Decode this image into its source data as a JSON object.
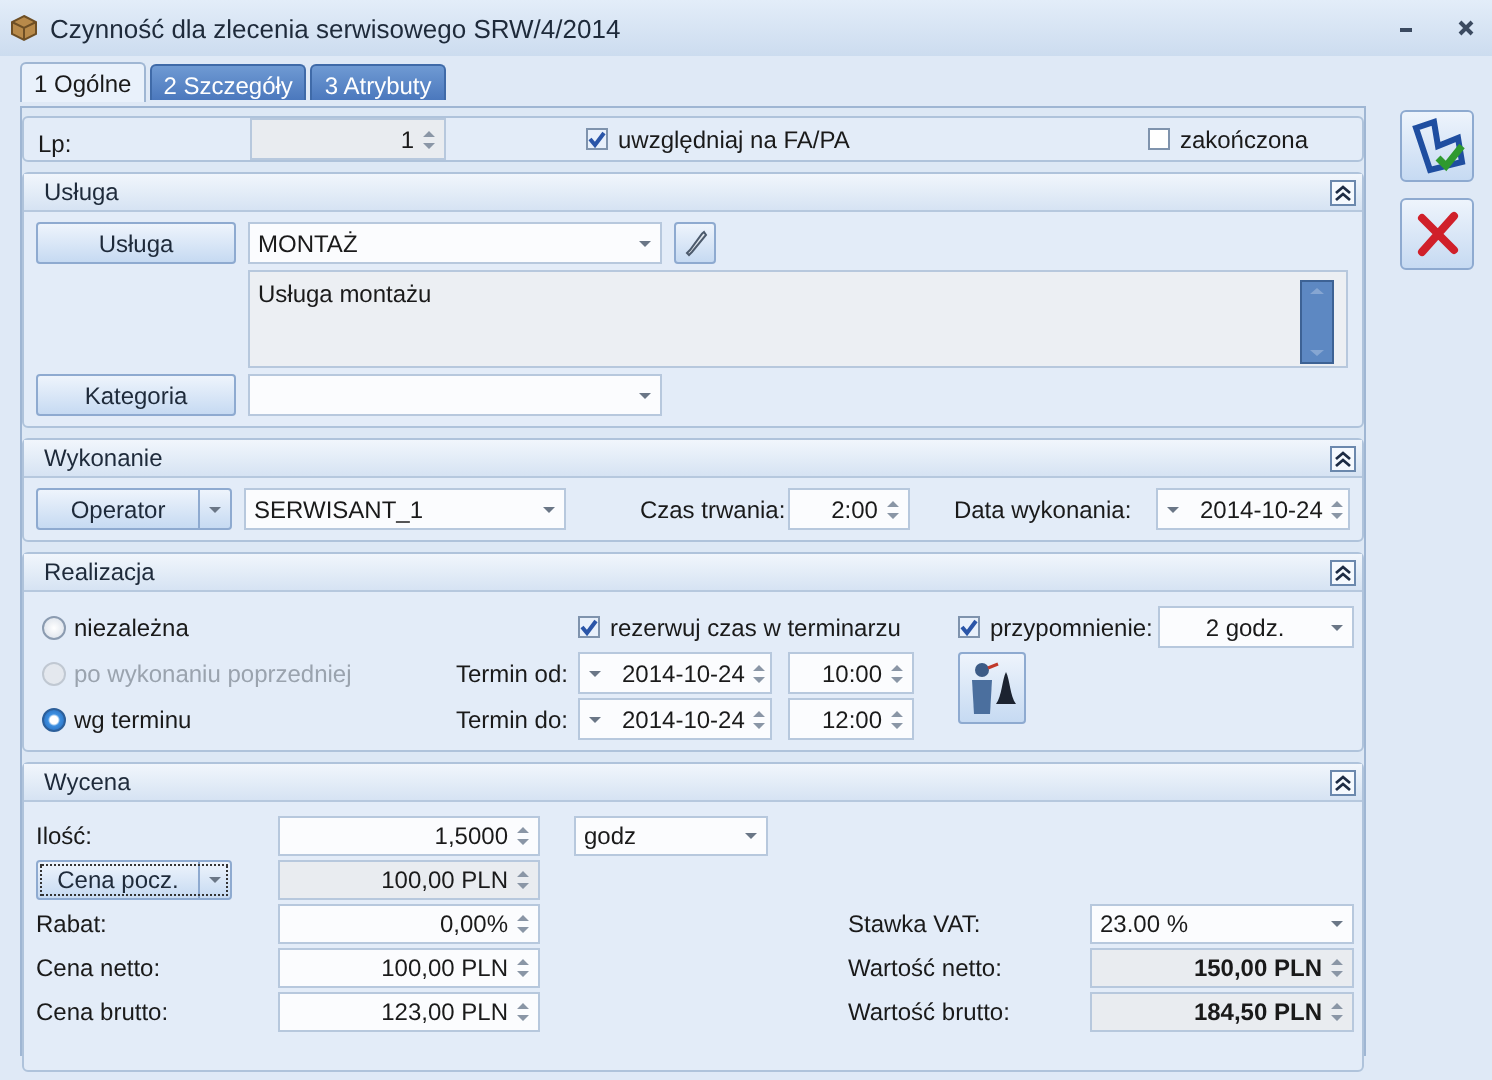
{
  "window": {
    "title": "Czynność dla zlecenia serwisowego SRW/4/2014"
  },
  "tabs": [
    {
      "label": "1 Ogólne",
      "selected": true
    },
    {
      "label": "2 Szczegóły",
      "selected": false
    },
    {
      "label": "3 Atrybuty",
      "selected": false
    }
  ],
  "header": {
    "lp_label": "Lp:",
    "lp_value": "1",
    "include": {
      "label": "uwzględniaj na FA/PA",
      "checked": true
    },
    "finished": {
      "label": "zakończona",
      "checked": false
    }
  },
  "usluga": {
    "title": "Usługa",
    "service_button": "Usługa",
    "service_value": "MONTAŻ",
    "description": "Usługa montażu",
    "category_button": "Kategoria"
  },
  "wykonanie": {
    "title": "Wykonanie",
    "operator_button": "Operator",
    "operator_value": "SERWISANT_1",
    "duration_label": "Czas trwania:",
    "duration": "2:00",
    "date_label": "Data wykonania:",
    "date": "2014-10-24"
  },
  "realizacja": {
    "title": "Realizacja",
    "modes": [
      {
        "label": "niezależna",
        "selected": false,
        "disabled": false
      },
      {
        "label": "po wykonaniu poprzedniej",
        "selected": false,
        "disabled": true
      },
      {
        "label": "wg terminu",
        "selected": true,
        "disabled": false
      }
    ],
    "reserve": {
      "label": "rezerwuj czas w terminarzu",
      "checked": true
    },
    "terms": [
      {
        "label": "Termin od:",
        "date": "2014-10-24",
        "time": "10:00"
      },
      {
        "label": "Termin do:",
        "date": "2014-10-24",
        "time": "12:00"
      }
    ],
    "reminder": {
      "label": "przypomnienie:",
      "checked": true,
      "value": "2 godz."
    }
  },
  "wycena": {
    "title": "Wycena",
    "quantity": {
      "label": "Ilość:",
      "value": "1,5000",
      "unit": "godz"
    },
    "base_price": {
      "button": "Cena pocz.",
      "value": "100,00 PLN"
    },
    "discount": {
      "label": "Rabat:",
      "value": "0,00%"
    },
    "net_price": {
      "label": "Cena netto:",
      "value": "100,00 PLN"
    },
    "gross_price": {
      "label": "Cena brutto:",
      "value": "123,00 PLN"
    },
    "vat": {
      "label": "Stawka VAT:",
      "value": "23.00 %"
    },
    "net_value": {
      "label": "Wartość netto:",
      "value": "150,00 PLN"
    },
    "gross_value": {
      "label": "Wartość brutto:",
      "value": "184,50 PLN"
    }
  }
}
